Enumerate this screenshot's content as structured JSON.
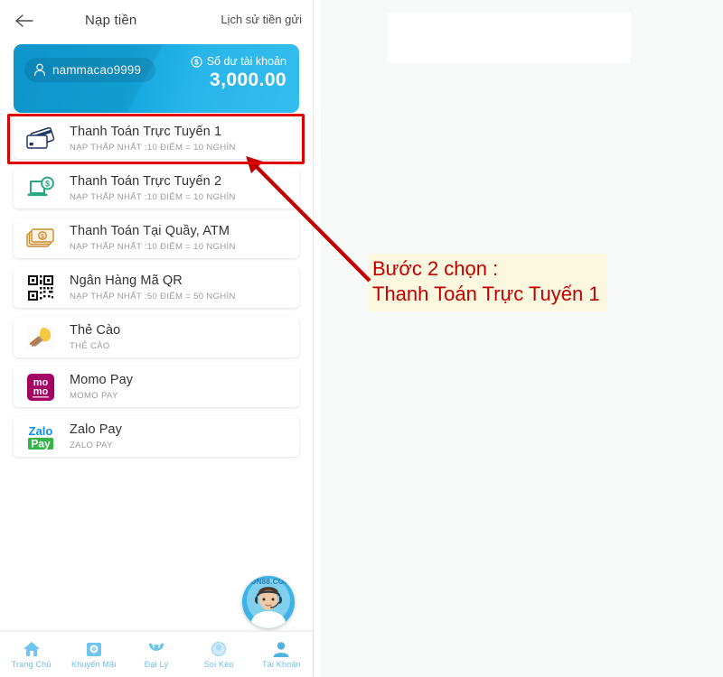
{
  "header": {
    "back_icon": "back-arrow-icon",
    "title": "Nạp tiền",
    "history_link": "Lịch sử tiền gửi"
  },
  "balance_card": {
    "user_icon": "user-icon",
    "username": "nammacao9999",
    "money_icon": "dollar-circle-icon",
    "balance_label": "Số dư tài khoản",
    "balance_amount": "3,000.00",
    "gradient_from": "#0f9ed8",
    "gradient_to": "#33bdee"
  },
  "payment_methods": [
    {
      "icon": "credit-cards-icon",
      "title": "Thanh Toán Trực Tuyến 1",
      "subtitle": "NẠP THẤP NHẤT :10 ĐIỂM = 10 NGHÌN",
      "selected": true
    },
    {
      "icon": "laptop-money-icon",
      "title": "Thanh Toán Trực Tuyến 2",
      "subtitle": "NẠP THẤP NHẤT :10 ĐIỂM = 10 NGHÌN",
      "selected": false
    },
    {
      "icon": "banknotes-icon",
      "title": "Thanh Toán Tại Quầy, ATM",
      "subtitle": "NẠP THẤP NHẤT :10 ĐIỂM = 10 NGHÌN",
      "selected": false
    },
    {
      "icon": "qr-code-icon",
      "title": "Ngân Hàng Mã QR",
      "subtitle": "NẠP THẤP NHẤT :50 ĐIỂM = 50 NGHÌN",
      "selected": false
    },
    {
      "icon": "scratch-card-icon",
      "title": "Thẻ Cào",
      "subtitle": "THẺ CÀO",
      "selected": false
    },
    {
      "icon": "momo-logo-icon",
      "title": "Momo Pay",
      "subtitle": "MOMO PAY",
      "selected": false
    },
    {
      "icon": "zalopay-logo-icon",
      "title": "Zalo Pay",
      "subtitle": "ZALO PAY",
      "selected": false
    }
  ],
  "support": {
    "avatar_icon": "support-agent-avatar",
    "watermark": "JUN88.COM"
  },
  "bottom_nav": [
    {
      "icon": "home-icon",
      "label": "Trang Chủ"
    },
    {
      "icon": "promotion-icon",
      "label": "Khuyến Mãi"
    },
    {
      "icon": "agency-icon",
      "label": "Đại Lý"
    },
    {
      "icon": "odds-icon",
      "label": "Soi Kèo"
    },
    {
      "icon": "account-icon",
      "label": "Tài Khoản"
    }
  ],
  "annotation": {
    "line1": "Bước 2 chọn :",
    "line2": "Thanh Toán Trực Tuyến 1",
    "text_color": "#c00000",
    "highlight_bg": "#fbf8df",
    "arrow_color": "#c00000",
    "box_border_color": "#e00000"
  }
}
